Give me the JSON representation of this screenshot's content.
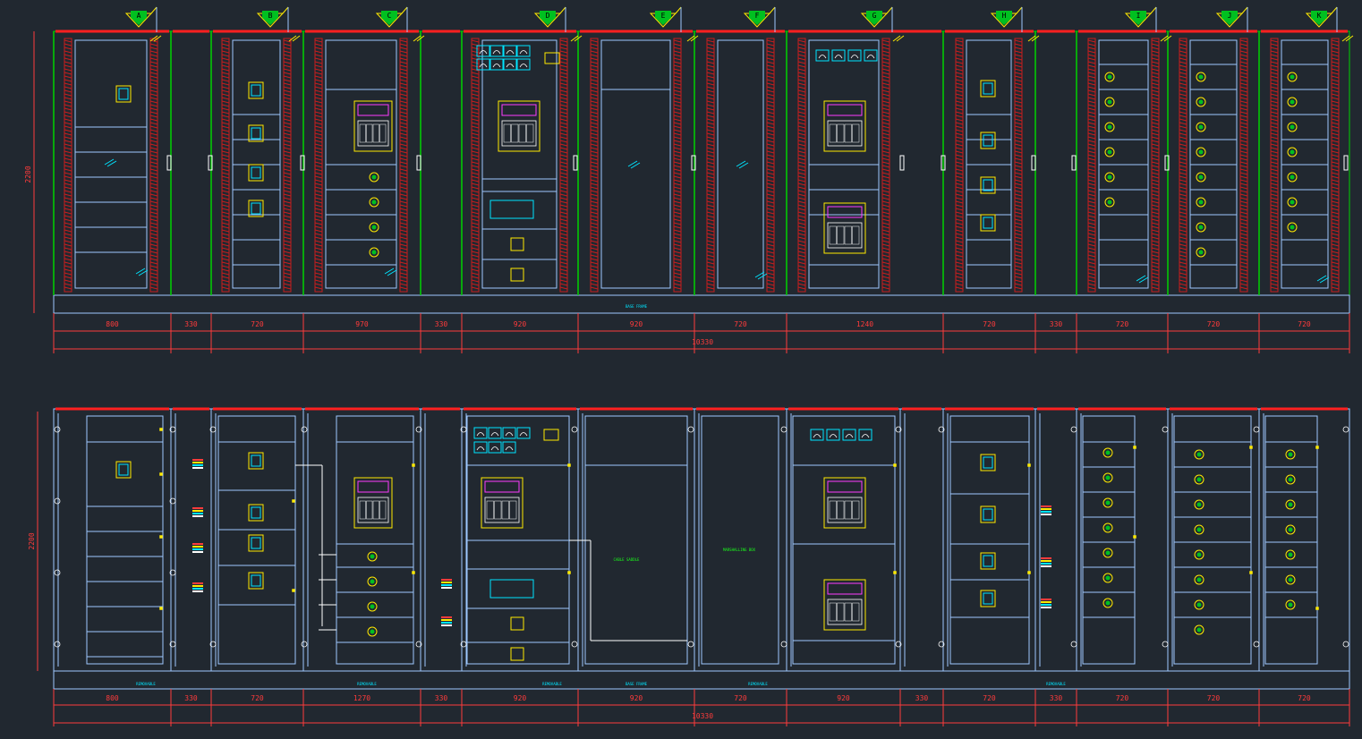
{
  "colors": {
    "background": "#212830",
    "frame": "#00d200",
    "cabinet": "#9ec8ff",
    "door_edge": "#ff2020",
    "dimension": "#ff3b3b",
    "hatch": "#c81e1e",
    "breaker": "#ffea00",
    "device": "#00e5ff",
    "tag_fill": "#00c020",
    "tag_edge": "#ffea00",
    "label_green": "#19ff19"
  },
  "icons": {
    "section_tag": "triangle-flag-icon",
    "meter": "meter-icon",
    "breaker": "breaker-icon",
    "outgoing": "outgoing-feeder-icon"
  },
  "sections": [
    {
      "tag": "A",
      "width": "800"
    },
    {
      "tag": "",
      "width": "330"
    },
    {
      "tag": "B",
      "width": "720"
    },
    {
      "tag": "C",
      "width": "970"
    },
    {
      "tag": "",
      "width": "330"
    },
    {
      "tag": "D",
      "width": "920"
    },
    {
      "tag": "E",
      "width": "920"
    },
    {
      "tag": "F",
      "width": "720"
    },
    {
      "tag": "G",
      "width": "1240"
    },
    {
      "tag": "H",
      "width": "720"
    },
    {
      "tag": "",
      "width": "330"
    },
    {
      "tag": "I",
      "width": "720"
    },
    {
      "tag": "J",
      "width": "720"
    },
    {
      "tag": "K",
      "width": "720"
    }
  ],
  "front_view": {
    "height_label": "2200",
    "total_width_label": "10330",
    "base_label": "BASE FRAME"
  },
  "rear_view": {
    "height_label": "2200",
    "total_width_label": "10330",
    "base_labels": [
      "REMOVABLE",
      "REMOVABLE",
      "REMOVABLE",
      "BASE FRAME",
      "REMOVABLE",
      "REMOVABLE"
    ],
    "section_e_label": "CABLE SADDLE",
    "section_f_label": "MARSHALLING BOX",
    "widths": [
      "800",
      "330",
      "720",
      "1270",
      "330",
      "920",
      "920",
      "720",
      "920",
      "330",
      "720",
      "330",
      "720",
      "720",
      "720"
    ]
  }
}
